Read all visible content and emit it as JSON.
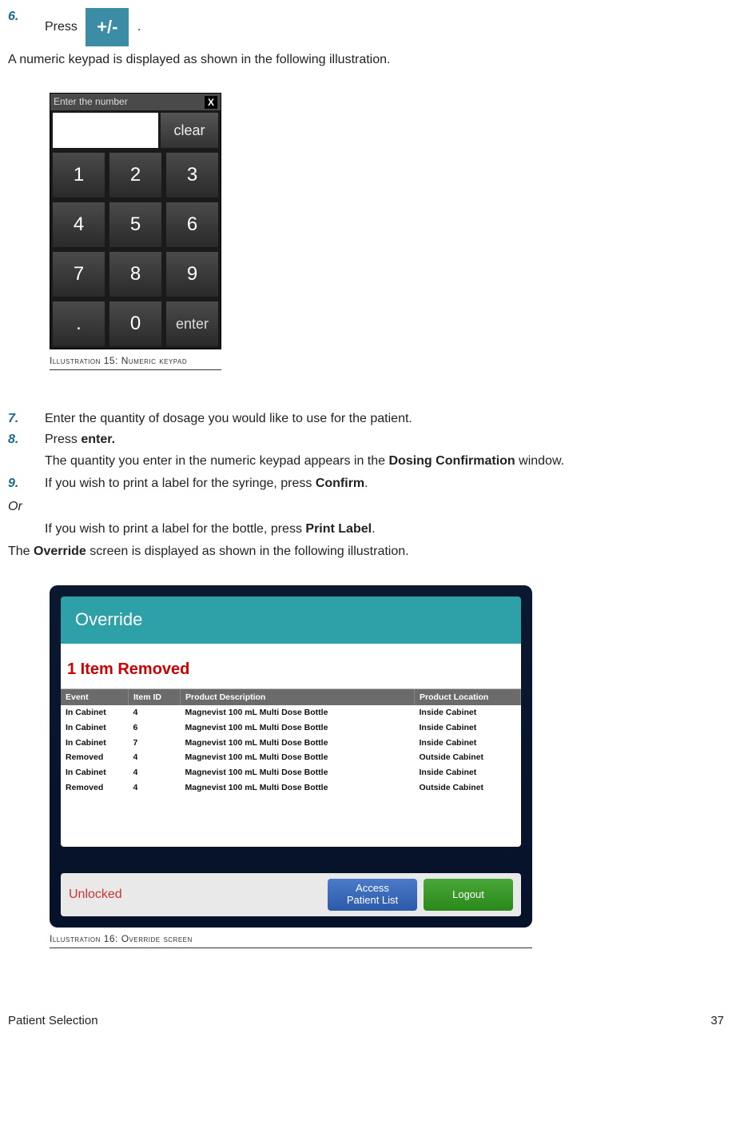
{
  "steps": {
    "s6": {
      "num": "6.",
      "text_before": "Press",
      "icon": "+/-",
      "text_after": "."
    },
    "s6_follow": "A numeric keypad is displayed as shown in the following illustration.",
    "s7": {
      "num": "7.",
      "text": "Enter the quantity of dosage you would like to use for the patient."
    },
    "s8": {
      "num": "8.",
      "text_before": "Press ",
      "bold": "enter."
    },
    "s8_follow_before": "The quantity you enter in the numeric keypad appears in the ",
    "s8_follow_bold": "Dosing Confirmation",
    "s8_follow_after": " window.",
    "s9": {
      "num": "9.",
      "text_before": "If you wish to print a label for the syringe, press ",
      "bold": "Confirm",
      "text_after": "."
    },
    "s9_or": "Or",
    "s9_b_before": "If you wish to print a label for the bottle, press ",
    "s9_b_bold": "Print Label",
    "s9_b_after": ".",
    "s9_c_before": "The ",
    "s9_c_bold": "Override",
    "s9_c_after": " screen is displayed as shown in the following illustration."
  },
  "keypad": {
    "title": "Enter the number",
    "close": "X",
    "clear": "clear",
    "keys": [
      "1",
      "2",
      "3",
      "4",
      "5",
      "6",
      "7",
      "8",
      "9",
      ".",
      "0",
      "enter"
    ],
    "caption": "Illustration 15: Numeric keypad"
  },
  "override": {
    "title": "Override",
    "banner": "1 Item Removed",
    "columns": [
      "Event",
      "Item ID",
      "Product Description",
      "Product Location"
    ],
    "rows": [
      {
        "event": "In Cabinet",
        "id": "4",
        "desc": "Magnevist 100 mL Multi Dose Bottle",
        "loc": "Inside Cabinet"
      },
      {
        "event": "In Cabinet",
        "id": "6",
        "desc": "Magnevist 100 mL Multi Dose Bottle",
        "loc": "Inside Cabinet"
      },
      {
        "event": "In Cabinet",
        "id": "7",
        "desc": "Magnevist 100 mL Multi Dose Bottle",
        "loc": "Inside Cabinet"
      },
      {
        "event": "Removed",
        "id": "4",
        "desc": "Magnevist 100 mL Multi Dose Bottle",
        "loc": "Outside Cabinet"
      },
      {
        "event": "In Cabinet",
        "id": "4",
        "desc": "Magnevist 100 mL Multi Dose Bottle",
        "loc": "Inside Cabinet"
      },
      {
        "event": "Removed",
        "id": "4",
        "desc": "Magnevist 100 mL Multi Dose Bottle",
        "loc": "Outside Cabinet"
      }
    ],
    "unlocked": "Unlocked",
    "btn_access_l1": "Access",
    "btn_access_l2": "Patient List",
    "btn_logout": "Logout",
    "caption": "Illustration 16: Override screen"
  },
  "footer": {
    "section": "Patient Selection",
    "page": "37"
  }
}
